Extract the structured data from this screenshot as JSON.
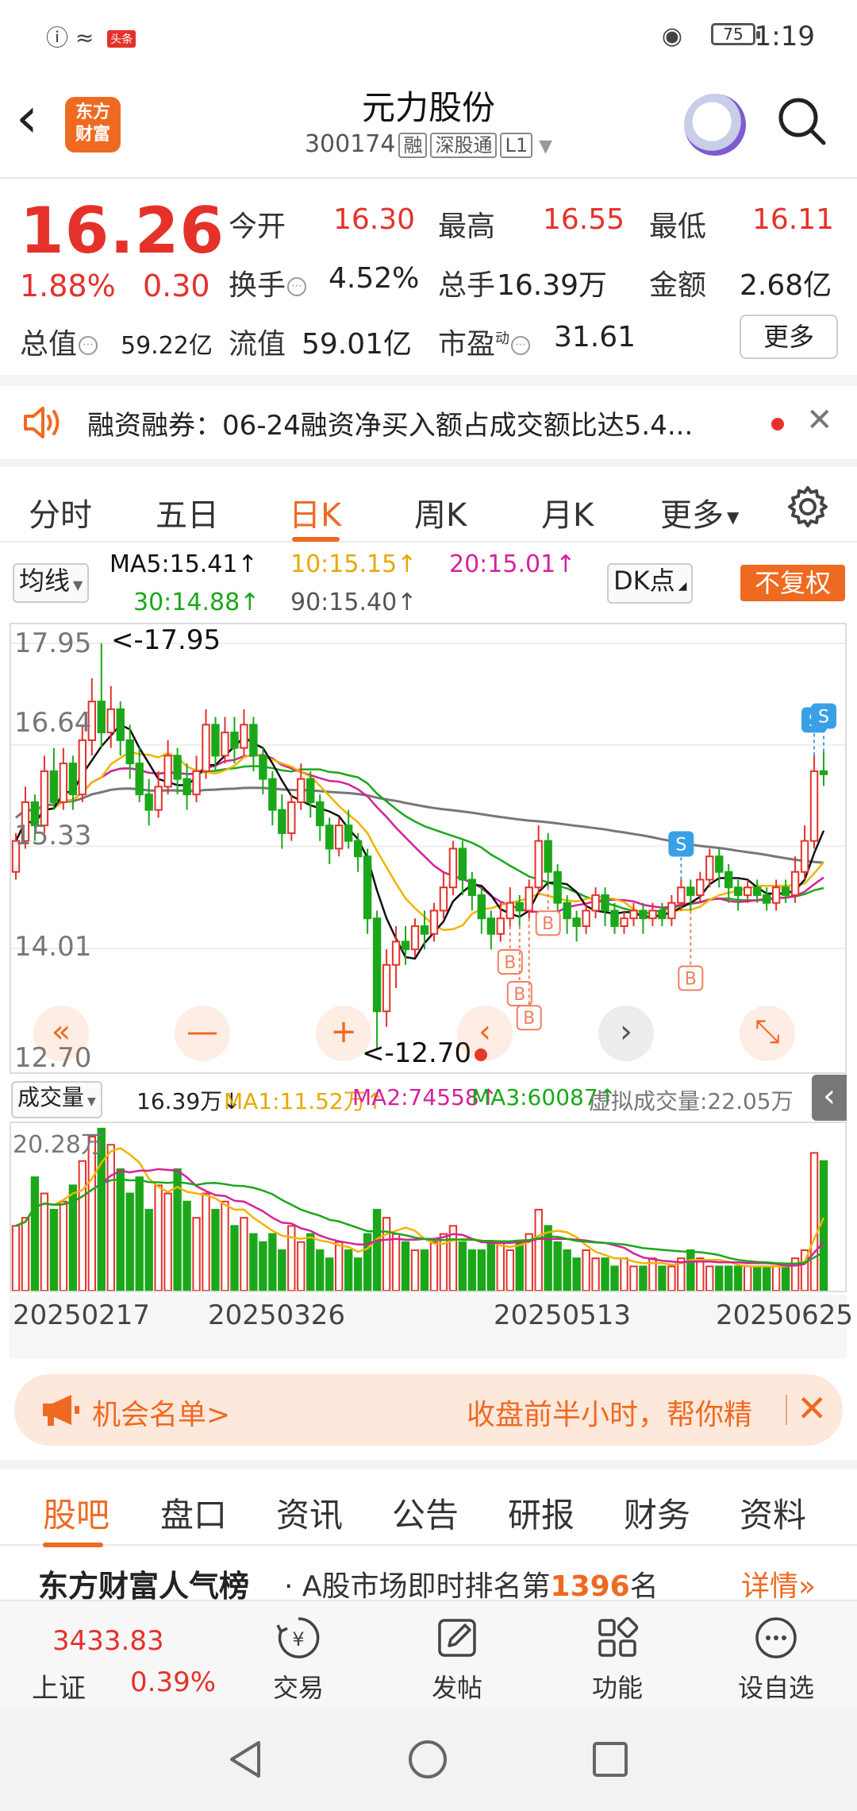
{
  "status_bar": {
    "time": "1:19",
    "battery": "75",
    "news_badge": "头条"
  },
  "header": {
    "title": "元力股份",
    "code": "300174",
    "tags": [
      "融",
      "深股通",
      "L1"
    ],
    "logo_text": "东方财富"
  },
  "quote": {
    "price": "16.26",
    "change_pct": "1.88%",
    "change": "0.30",
    "open_label": "今开",
    "open": "16.30",
    "high_label": "最高",
    "high": "16.55",
    "low_label": "最低",
    "low": "16.11",
    "turnover_label": "换手",
    "turnover": "4.52%",
    "volume_label": "总手",
    "volume": "16.39万",
    "amount_label": "金额",
    "amount": "2.68亿",
    "mktcap_label": "总值",
    "mktcap": "59.22亿",
    "float_label": "流值",
    "float_cap": "59.01亿",
    "pe_label": "市盈",
    "pe_sup": "动",
    "pe": "31.61",
    "more_label": "更多"
  },
  "notice": {
    "text": "融资融券：06-24融资净买入额占成交额比达5.4..."
  },
  "period_tabs": [
    "分时",
    "五日",
    "日K",
    "周K",
    "月K",
    "更多"
  ],
  "active_tab": "日K",
  "ma_legend": {
    "select_label": "均线",
    "ma5": "MA5:15.41↑",
    "ma10": "10:15.15↑",
    "ma20": "20:15.01↑",
    "ma30": "30:14.88↑",
    "ma90": "90:15.40↑",
    "dk_label": "DK点",
    "fq_label": "不复权"
  },
  "colors": {
    "accent": "#ef6a21",
    "up": "#e4322b",
    "down": "#1aa81a",
    "ma5": "#111111",
    "ma10": "#f0b400",
    "ma20": "#d6219b",
    "ma30": "#1aa81a",
    "ma90": "#777777",
    "signal_s": "#3aa0e6",
    "signal_b": "#f08060"
  },
  "chart_data": {
    "type": "candlestick",
    "y_ticks": [
      "17.95",
      "16.64",
      "15.33",
      "14.01",
      "12.70"
    ],
    "ylim": [
      12.7,
      17.95
    ],
    "x_ticks": [
      "20250217",
      "20250326",
      "20250513",
      "20250625"
    ],
    "max_annotation": "<-17.95",
    "min_annotation": "<-12.70",
    "candles": [
      [
        15.0,
        15.4,
        14.9,
        15.5
      ],
      [
        15.4,
        15.9,
        15.3,
        16.1
      ],
      [
        15.9,
        15.6,
        15.4,
        16.0
      ],
      [
        15.6,
        16.3,
        15.5,
        16.5
      ],
      [
        16.3,
        15.9,
        15.8,
        16.6
      ],
      [
        15.9,
        16.4,
        15.8,
        16.6
      ],
      [
        16.4,
        16.0,
        15.8,
        16.5
      ],
      [
        16.0,
        16.7,
        15.9,
        16.9
      ],
      [
        16.7,
        17.2,
        16.5,
        17.5
      ],
      [
        17.2,
        16.8,
        16.6,
        17.95
      ],
      [
        16.8,
        17.1,
        16.6,
        17.4
      ],
      [
        17.1,
        16.7,
        16.5,
        17.2
      ],
      [
        16.7,
        16.4,
        16.2,
        16.9
      ],
      [
        16.4,
        16.0,
        15.9,
        16.6
      ],
      [
        16.0,
        15.8,
        15.6,
        16.2
      ],
      [
        15.8,
        16.1,
        15.7,
        16.3
      ],
      [
        16.1,
        16.5,
        16.0,
        16.7
      ],
      [
        16.5,
        16.2,
        16.0,
        16.6
      ],
      [
        16.2,
        16.0,
        15.8,
        16.4
      ],
      [
        16.0,
        16.3,
        15.9,
        16.5
      ],
      [
        16.3,
        16.9,
        16.2,
        17.1
      ],
      [
        16.9,
        16.5,
        16.3,
        17.0
      ],
      [
        16.5,
        16.8,
        16.4,
        17.0
      ],
      [
        16.8,
        16.6,
        16.4,
        17.0
      ],
      [
        16.6,
        16.9,
        16.5,
        17.1
      ],
      [
        16.9,
        16.5,
        16.3,
        17.0
      ],
      [
        16.5,
        16.2,
        16.0,
        16.6
      ],
      [
        16.2,
        15.8,
        15.6,
        16.3
      ],
      [
        15.8,
        15.5,
        15.3,
        16.0
      ],
      [
        15.5,
        15.9,
        15.4,
        16.0
      ],
      [
        15.9,
        16.2,
        15.8,
        16.4
      ],
      [
        16.2,
        15.9,
        15.7,
        16.3
      ],
      [
        15.9,
        15.6,
        15.4,
        16.0
      ],
      [
        15.6,
        15.3,
        15.1,
        15.7
      ],
      [
        15.3,
        15.6,
        15.2,
        15.7
      ],
      [
        15.6,
        15.4,
        15.3,
        15.8
      ],
      [
        15.4,
        15.2,
        15.0,
        15.5
      ],
      [
        15.2,
        14.4,
        14.2,
        15.3
      ],
      [
        14.4,
        13.2,
        12.7,
        14.5
      ],
      [
        13.2,
        13.8,
        13.0,
        14.0
      ],
      [
        13.8,
        14.1,
        13.5,
        14.3
      ],
      [
        14.1,
        14.0,
        13.8,
        14.3
      ],
      [
        14.0,
        14.3,
        13.9,
        14.4
      ],
      [
        14.3,
        14.2,
        14.0,
        14.5
      ],
      [
        14.2,
        14.5,
        14.1,
        14.6
      ],
      [
        14.5,
        14.8,
        14.4,
        15.0
      ],
      [
        14.8,
        15.3,
        14.7,
        15.4
      ],
      [
        15.3,
        14.9,
        14.7,
        15.4
      ],
      [
        14.9,
        14.7,
        14.5,
        15.0
      ],
      [
        14.7,
        14.4,
        14.2,
        14.8
      ],
      [
        14.4,
        14.2,
        14.0,
        14.5
      ],
      [
        14.2,
        14.4,
        14.1,
        14.6
      ],
      [
        14.4,
        14.6,
        14.3,
        14.8
      ],
      [
        14.6,
        14.5,
        14.3,
        14.7
      ],
      [
        14.5,
        14.8,
        14.4,
        14.9
      ],
      [
        14.8,
        15.4,
        14.7,
        15.6
      ],
      [
        15.4,
        15.0,
        14.8,
        15.5
      ],
      [
        15.0,
        14.6,
        14.3,
        15.1
      ],
      [
        14.6,
        14.4,
        14.2,
        14.7
      ],
      [
        14.4,
        14.3,
        14.1,
        14.5
      ],
      [
        14.3,
        14.5,
        14.2,
        14.6
      ],
      [
        14.5,
        14.7,
        14.4,
        14.8
      ],
      [
        14.7,
        14.5,
        14.3,
        14.8
      ],
      [
        14.5,
        14.3,
        14.2,
        14.6
      ],
      [
        14.3,
        14.4,
        14.2,
        14.5
      ],
      [
        14.4,
        14.5,
        14.3,
        14.6
      ],
      [
        14.5,
        14.4,
        14.2,
        14.6
      ],
      [
        14.4,
        14.5,
        14.3,
        14.6
      ],
      [
        14.5,
        14.4,
        14.3,
        14.6
      ],
      [
        14.4,
        14.6,
        14.3,
        14.7
      ],
      [
        14.6,
        14.8,
        14.5,
        14.9
      ],
      [
        14.8,
        14.7,
        14.5,
        14.9
      ],
      [
        14.7,
        14.9,
        14.6,
        15.0
      ],
      [
        14.9,
        15.2,
        14.8,
        15.3
      ],
      [
        15.2,
        15.0,
        14.8,
        15.3
      ],
      [
        15.0,
        14.8,
        14.6,
        15.1
      ],
      [
        14.8,
        14.7,
        14.5,
        14.9
      ],
      [
        14.7,
        14.8,
        14.6,
        14.9
      ],
      [
        14.8,
        14.7,
        14.6,
        14.9
      ],
      [
        14.7,
        14.6,
        14.5,
        14.8
      ],
      [
        14.6,
        14.8,
        14.5,
        14.9
      ],
      [
        14.8,
        14.7,
        14.6,
        14.9
      ],
      [
        14.7,
        15.0,
        14.6,
        15.2
      ],
      [
        15.0,
        15.4,
        14.9,
        15.6
      ],
      [
        15.4,
        16.3,
        15.3,
        16.5
      ],
      [
        16.3,
        16.26,
        16.11,
        16.55
      ]
    ],
    "signals": [
      {
        "type": "S",
        "index": 70
      },
      {
        "type": "S",
        "index": 84
      },
      {
        "type": "S",
        "index": 85
      },
      {
        "type": "B",
        "index": 52
      },
      {
        "type": "B",
        "index": 53
      },
      {
        "type": "B",
        "index": 54
      },
      {
        "type": "B",
        "index": 56
      },
      {
        "type": "B",
        "index": 71
      }
    ]
  },
  "volume": {
    "label": "成交量",
    "value": "16.39万↓",
    "ma1": "MA1:11.52万↑",
    "ma2": "MA2:74558↑",
    "ma3": "MA3:60087↑",
    "virtual": "虚拟成交量:22.05万",
    "max_tick": "20.28万",
    "bars": [
      8,
      9,
      14,
      12,
      10,
      11,
      13,
      16,
      19,
      20,
      18,
      15,
      12,
      14,
      10,
      13,
      12,
      15,
      11,
      9,
      12,
      10,
      11,
      8,
      9,
      7,
      6,
      7,
      5,
      8,
      6,
      7,
      5,
      4,
      6,
      5,
      4,
      7,
      10,
      9,
      7,
      6,
      5,
      5,
      6,
      7,
      8,
      6,
      5,
      5,
      6,
      6,
      5,
      6,
      7,
      10,
      8,
      6,
      5,
      4,
      5,
      4,
      4,
      3,
      4,
      3,
      3,
      4,
      3,
      3,
      4,
      5,
      4,
      3,
      3,
      3,
      3,
      3,
      3,
      3,
      3,
      3,
      4,
      5,
      17,
      16
    ]
  },
  "chart_controls": [
    "«",
    "—",
    "+",
    "‹",
    "›",
    "⤡"
  ],
  "opportunity": {
    "title": "机会名单>",
    "text": "收盘前半小时，帮你精"
  },
  "bottom_tabs": [
    "股吧",
    "盘口",
    "资讯",
    "公告",
    "研报",
    "财务",
    "资料"
  ],
  "rank": {
    "title": "东方财富人气榜",
    "text_a": "· A股市场即时排名第",
    "rank_no": "1396",
    "text_b": "名",
    "detail": "详情"
  },
  "toolbar": {
    "index_value": "3433.83",
    "index_name": "上证",
    "index_pct": "0.39%",
    "items": [
      "交易",
      "发帖",
      "功能",
      "设自选"
    ]
  }
}
